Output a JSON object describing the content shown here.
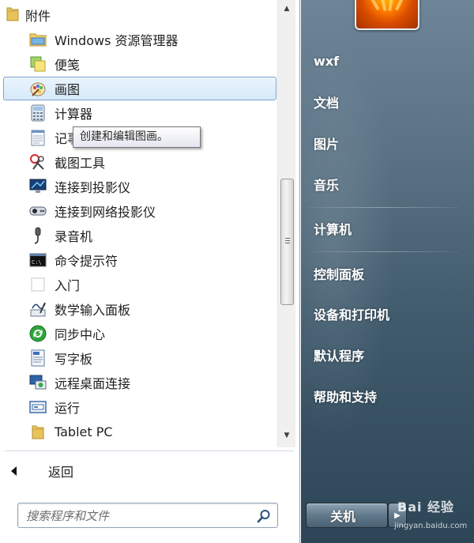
{
  "folder": {
    "label": "附件",
    "icon": "folder-icon"
  },
  "items": [
    {
      "label": "Windows 资源管理器",
      "icon": "explorer-icon"
    },
    {
      "label": "便笺",
      "icon": "sticky-notes-icon"
    },
    {
      "label": "画图",
      "icon": "paint-icon"
    },
    {
      "label": "计算器",
      "icon": "calculator-icon"
    },
    {
      "label": "记事本",
      "icon": "notepad-icon"
    },
    {
      "label": "截图工具",
      "icon": "snipping-tool-icon"
    },
    {
      "label": "连接到投影仪",
      "icon": "projector-icon"
    },
    {
      "label": "连接到网络投影仪",
      "icon": "network-projector-icon"
    },
    {
      "label": "录音机",
      "icon": "microphone-icon"
    },
    {
      "label": "命令提示符",
      "icon": "cmd-icon"
    },
    {
      "label": "入门",
      "icon": "getting-started-icon"
    },
    {
      "label": "数学输入面板",
      "icon": "math-input-icon"
    },
    {
      "label": "同步中心",
      "icon": "sync-center-icon"
    },
    {
      "label": "写字板",
      "icon": "wordpad-icon"
    },
    {
      "label": "远程桌面连接",
      "icon": "remote-desktop-icon"
    },
    {
      "label": "运行",
      "icon": "run-icon"
    },
    {
      "label": "Tablet PC",
      "icon": "folder-icon"
    }
  ],
  "tooltip": "创建和编辑图画。",
  "back": {
    "label": "返回"
  },
  "search": {
    "placeholder": "搜索程序和文件"
  },
  "right_menu": {
    "username": "wxf",
    "items": [
      "文档",
      "图片",
      "音乐",
      "计算机",
      "控制面板",
      "设备和打印机",
      "默认程序",
      "帮助和支持"
    ]
  },
  "shutdown": {
    "label": "关机"
  },
  "watermark": {
    "text": "Bai 经验",
    "sub": "jingyan.baidu.com"
  },
  "colors": {
    "hover_bg": "#dbeafa",
    "hover_border": "#7da2ce",
    "right_pane": "#4e687a"
  }
}
